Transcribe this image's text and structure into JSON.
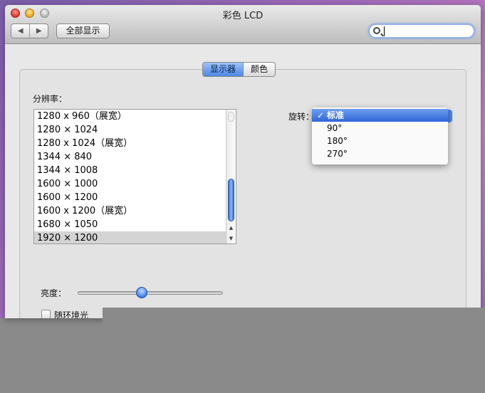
{
  "window": {
    "title": "彩色 LCD"
  },
  "toolbar": {
    "back_icon": "◀",
    "forward_icon": "▶",
    "show_all_label": "全部显示",
    "search_value": ""
  },
  "tabs": [
    {
      "label": "显示器",
      "active": true
    },
    {
      "label": "颜色",
      "active": false
    }
  ],
  "resolutions": {
    "label": "分辨率：",
    "items": [
      "1280 x 960（展宽）",
      "1280 × 1024",
      "1280 x 1024（展宽）",
      "1344 × 840",
      "1344 × 1008",
      "1600 × 1000",
      "1600 × 1200",
      "1600 x 1200（展宽）",
      "1680 × 1050",
      "1920 × 1200"
    ],
    "selected_index": 9
  },
  "rotation": {
    "label": "旋转：",
    "check_mark": "✓",
    "options": [
      "标准",
      "90°",
      "180°",
      "270°"
    ],
    "selected": "标准"
  },
  "brightness": {
    "label": "亮度：",
    "level": 0.45
  },
  "auto_brightness": {
    "label": "随环境光",
    "checked": false
  },
  "colors": {
    "accent": "#3b74e0",
    "selection_gray": "#d4d4d4"
  }
}
